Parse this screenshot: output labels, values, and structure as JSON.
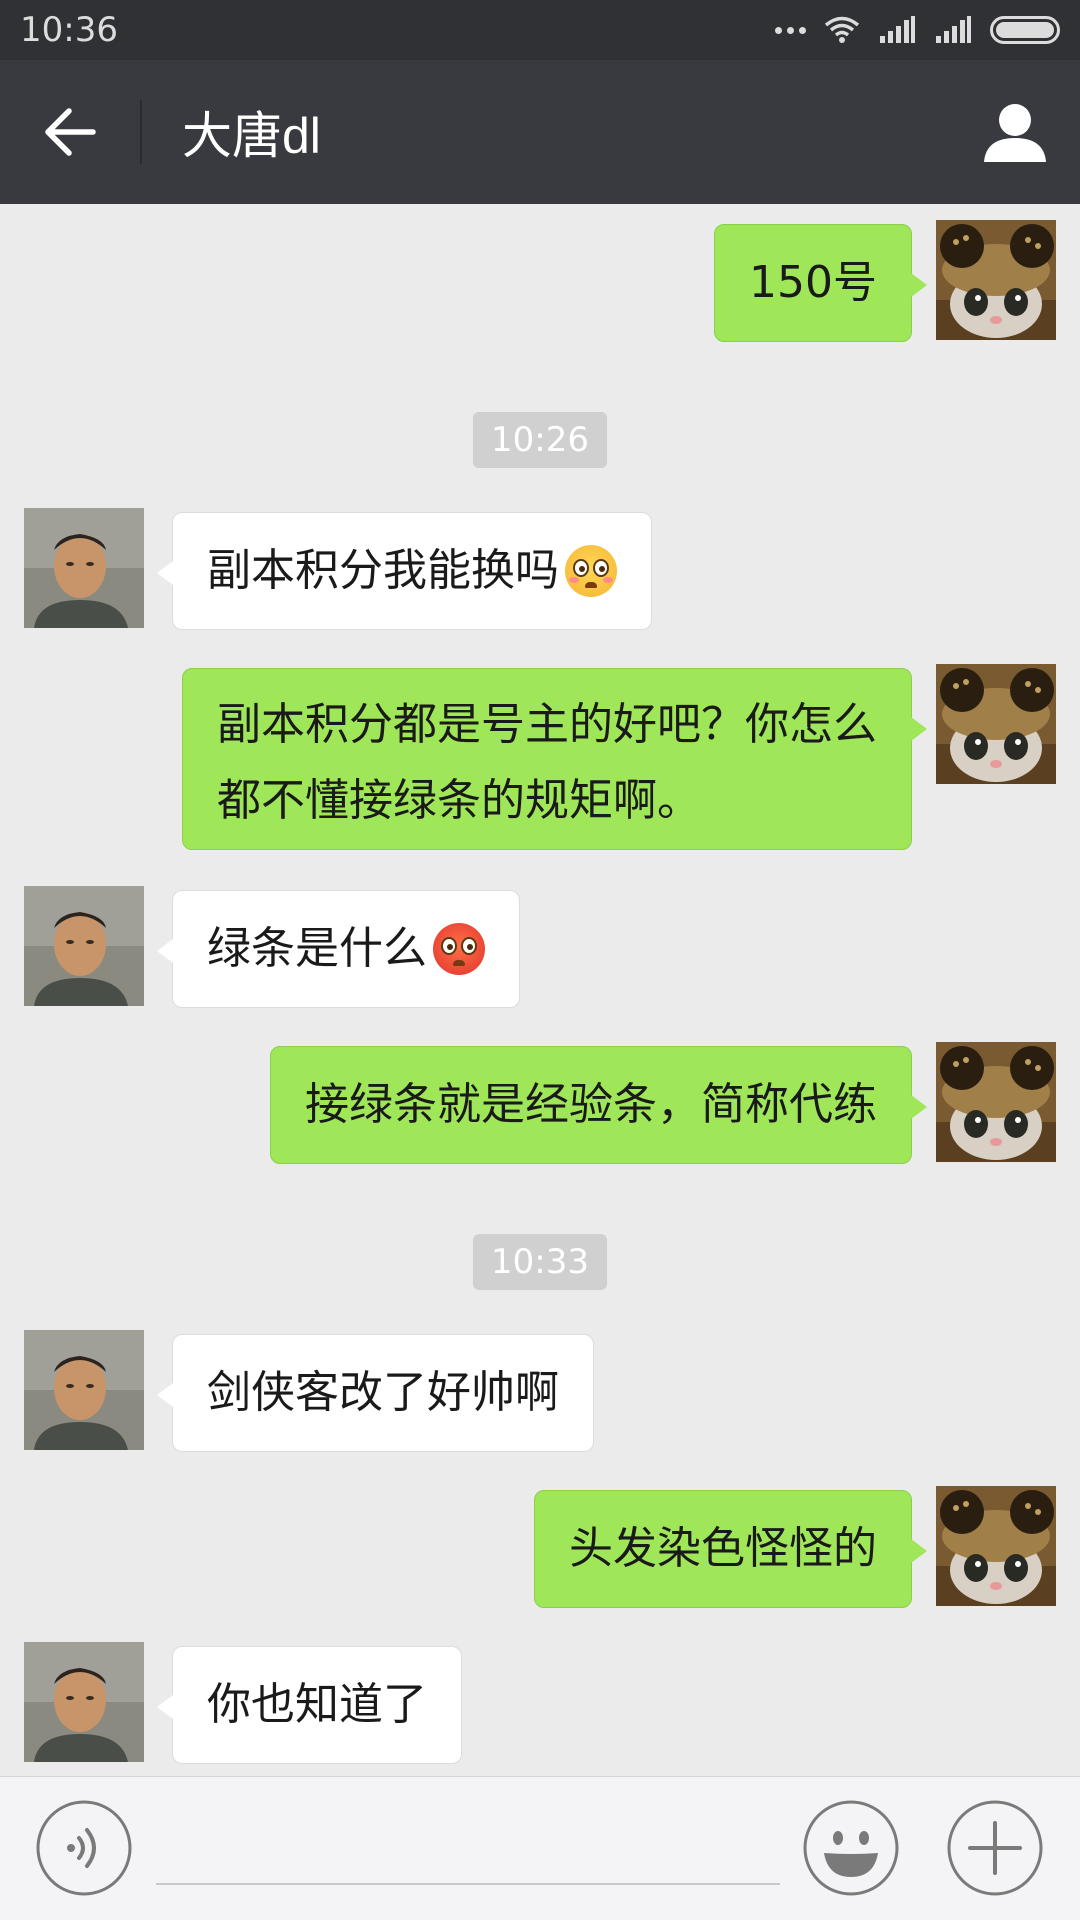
{
  "status_bar": {
    "time": "10:36",
    "icons": [
      "more-dots-icon",
      "wifi-icon",
      "signal-icon",
      "signal-icon",
      "battery-icon"
    ]
  },
  "header": {
    "back_icon": "back-arrow-icon",
    "title": "大唐dl",
    "profile_icon": "person-icon"
  },
  "messages": [
    {
      "type": "text",
      "sender": "me",
      "text": "150号"
    },
    {
      "type": "time",
      "text": "10:26"
    },
    {
      "type": "text",
      "sender": "other",
      "text": "副本积分我能换吗",
      "emoji": "flushed-face"
    },
    {
      "type": "text",
      "sender": "me",
      "lines": [
        "副本积分都是号主的好吧？你怎么",
        "都不懂接绿条的规矩啊。"
      ]
    },
    {
      "type": "text",
      "sender": "other",
      "text": "绿条是什么",
      "emoji": "hot-face"
    },
    {
      "type": "text",
      "sender": "me",
      "text": "接绿条就是经验条，简称代练"
    },
    {
      "type": "time",
      "text": "10:33"
    },
    {
      "type": "text",
      "sender": "other",
      "text": "剑侠客改了好帅啊"
    },
    {
      "type": "text",
      "sender": "me",
      "text": "头发染色怪怪的"
    },
    {
      "type": "text",
      "sender": "other",
      "text": "你也知道了"
    }
  ],
  "input_bar": {
    "voice_icon": "voice-icon",
    "input_value": "",
    "emoji_icon": "smiley-icon",
    "plus_icon": "plus-icon"
  },
  "colors": {
    "my_bubble": "#9fe658",
    "other_bubble": "#ffffff",
    "nav_bar": "#393a3f",
    "background": "#ebebeb"
  }
}
